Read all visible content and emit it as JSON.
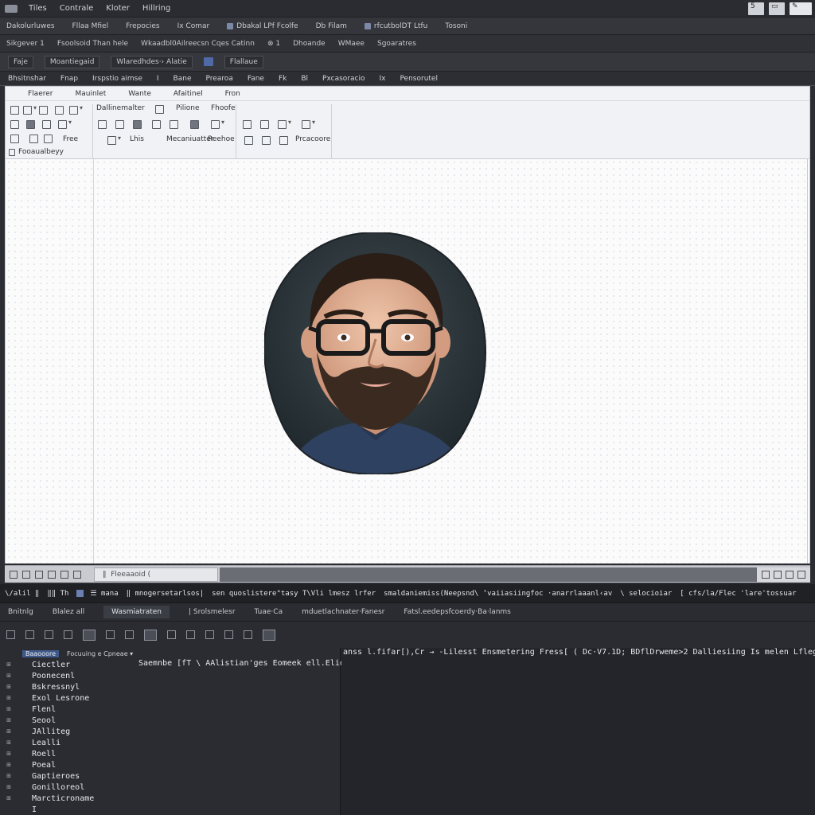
{
  "titlebar": {
    "menus": [
      "Tiles",
      "Contrale",
      "Kloter",
      "Hillring"
    ],
    "right_buttons": [
      "5",
      "▭",
      "✎"
    ]
  },
  "tabrow": [
    "Dakolurluwes",
    "Fllaa Mfiel",
    "Frepocies",
    "Ix Comar",
    "Dbakal LPf Fcolfe",
    "Db Filam",
    "rfcutbolDT Ltfu",
    "Tosoni"
  ],
  "pathrow": [
    "Sikgever 1",
    "Fsoolsoid Than hele",
    "Wkaadbl0Ailreecsn Cqes Catinn",
    "⊗ 1",
    "Dhoande",
    "WMaee",
    "Sgoaratres"
  ],
  "fieldrow": [
    "Faje",
    "Moantiegaid",
    "Wlaredhdes·› Alatie",
    "Flallaue"
  ],
  "menurow": [
    "Bhsitnshar",
    "Fnap",
    "Irspstio aimse",
    "I",
    "Bane",
    "Prearoa",
    "Fane",
    "Fk",
    "Bl",
    "Pxcasoracio",
    "Ix",
    "Pensorutel"
  ],
  "ribbon": {
    "tabs": [
      "Flaerer",
      "Mauinlet",
      "Wante",
      "Afaitinel",
      "Fron"
    ],
    "labels": {
      "free": "Free",
      "group2_title": "Dallinemalter",
      "g2_t1": "Pilione",
      "g2_t2": "Fhoofe",
      "g2_b1": "Lhis",
      "g2_b2": "Mecaniuatter",
      "g2_b3": "Reehoe",
      "g3_b1": "Prcacoore",
      "status": "Fooaualbeyy"
    }
  },
  "canvasstatus": {
    "field": "‖  Fleeaaoid ("
  },
  "console": {
    "head": [
      "\\/alil ‖",
      "‖‖ Th",
      "☰ mana",
      "‖ mnogersetarlsos|",
      "sen quoslistere°tasy T\\Vli lmesz lrfer",
      "smaldaniemiss(Neepsnd\\ ‘vaiiasiingfoc ·anarrlaaanl‹av",
      "\\ selocioiar",
      "[ cfs/la/Flec 'lare'tossuar"
    ],
    "tabs": [
      "Bnitnlg",
      "Blalez all",
      "Wasmiatraten",
      "| Srolsmelesr",
      "Tuae·Ca",
      "mduetlachnater·Fanesr",
      "Fatsl.eedepsfcoerdy·Ba·lanms"
    ],
    "left_header": {
      "sel": "Baaooore",
      "col": "Focuuing e Cpneae ▾"
    },
    "col_heading": "Saemnbe  [fT \\ AAlistian'ges Eomeek ell.Eliom",
    "rows": [
      "Ciectler",
      "Poonecenl",
      "Bskressnyl",
      "Exol Lesrone",
      "Flenl",
      "Seool",
      "JAlliteg",
      "Lealli",
      "Roell",
      "Poeal",
      "Gaptieroes",
      "Gonilloreol",
      "Marcticroname",
      "I"
    ],
    "right_line": "anss l.fifar[),Cr → -Lilesst Ensmetering Fress[ ( Dc·V7.1D; BDflDrweme>2  Dalliesiing Is melen Lflegoe"
  }
}
